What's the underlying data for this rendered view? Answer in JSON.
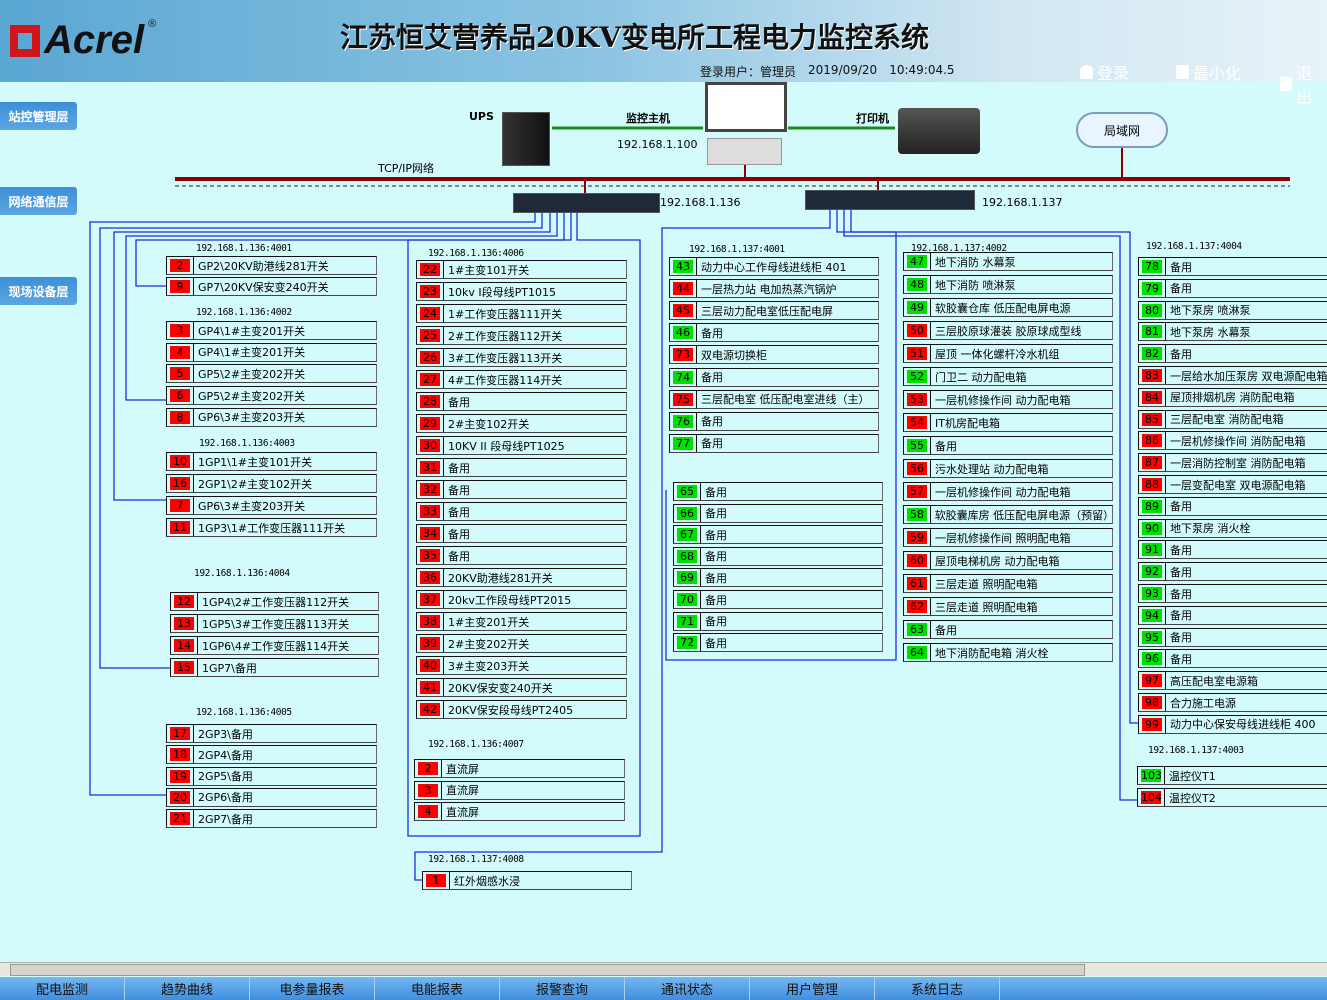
{
  "header": {
    "logo": "Acrel",
    "title": "江苏恒艾营养品20KV变电所工程电力监控系统",
    "user_label": "登录用户：",
    "user": "管理员",
    "date": "2019/09/20",
    "time": "10:49:04.5",
    "login": "登录",
    "minimize": "最小化",
    "exit": "退出"
  },
  "layers": {
    "station": "站控管理层",
    "network": "网络通信层",
    "field": "现场设备层"
  },
  "network": {
    "ups": "UPS",
    "host": "监控主机",
    "host_ip": "192.168.1.100",
    "printer": "打印机",
    "lan": "局域网",
    "tcp": "TCP/IP网络",
    "switch1_ip": "192.168.1.136",
    "switch2_ip": "192.168.1.137"
  },
  "colors": {
    "alarm": "#ff0000",
    "normal": "#00e000",
    "bus": "#8b0000",
    "link": "#1a8a1a",
    "wire": "#1a2fe0"
  },
  "groups": [
    {
      "ip": "192.168.1.136:4001",
      "items": [
        {
          "n": "2",
          "label": "GP2\\20KV助港线281开关",
          "s": "alarm"
        },
        {
          "n": "9",
          "label": "GP7\\20KV保安变240开关",
          "s": "alarm"
        }
      ]
    },
    {
      "ip": "192.168.1.136:4002",
      "items": [
        {
          "n": "3",
          "label": "GP4\\1#主变201开关",
          "s": "alarm"
        },
        {
          "n": "4",
          "label": "GP4\\1#主变201开关",
          "s": "alarm"
        },
        {
          "n": "5",
          "label": "GP5\\2#主变202开关",
          "s": "alarm"
        },
        {
          "n": "6",
          "label": "GP5\\2#主变202开关",
          "s": "alarm"
        },
        {
          "n": "8",
          "label": "GP6\\3#主变203开关",
          "s": "alarm"
        }
      ]
    },
    {
      "ip": "192.168.1.136:4003",
      "items": [
        {
          "n": "10",
          "label": "1GP1\\1#主变101开关",
          "s": "alarm"
        },
        {
          "n": "16",
          "label": "2GP1\\2#主变102开关",
          "s": "alarm"
        },
        {
          "n": "7",
          "label": "GP6\\3#主变203开关",
          "s": "alarm"
        },
        {
          "n": "11",
          "label": "1GP3\\1#工作变压器111开关",
          "s": "alarm"
        }
      ]
    },
    {
      "ip": "192.168.1.136:4004",
      "items": [
        {
          "n": "12",
          "label": "1GP4\\2#工作变压器112开关",
          "s": "alarm"
        },
        {
          "n": "13",
          "label": "1GP5\\3#工作变压器113开关",
          "s": "alarm"
        },
        {
          "n": "14",
          "label": "1GP6\\4#工作变压器114开关",
          "s": "alarm"
        },
        {
          "n": "15",
          "label": "1GP7\\备用",
          "s": "alarm"
        }
      ]
    },
    {
      "ip": "192.168.1.136:4005",
      "items": [
        {
          "n": "17",
          "label": "2GP3\\备用",
          "s": "alarm"
        },
        {
          "n": "18",
          "label": "2GP4\\备用",
          "s": "alarm"
        },
        {
          "n": "19",
          "label": "2GP5\\备用",
          "s": "alarm"
        },
        {
          "n": "20",
          "label": "2GP6\\备用",
          "s": "alarm"
        },
        {
          "n": "21",
          "label": "2GP7\\备用",
          "s": "alarm"
        }
      ]
    },
    {
      "ip": "192.168.1.136:4006",
      "items": [
        {
          "n": "22",
          "label": "1#主变101开关",
          "s": "alarm"
        },
        {
          "n": "23",
          "label": "10kv I段母线PT1015",
          "s": "alarm"
        },
        {
          "n": "24",
          "label": "1#工作变压器111开关",
          "s": "alarm"
        },
        {
          "n": "25",
          "label": "2#工作变压器112开关",
          "s": "alarm"
        },
        {
          "n": "26",
          "label": "3#工作变压器113开关",
          "s": "alarm"
        },
        {
          "n": "27",
          "label": "4#工作变压器114开关",
          "s": "alarm"
        },
        {
          "n": "28",
          "label": "备用",
          "s": "alarm"
        },
        {
          "n": "29",
          "label": "2#主变102开关",
          "s": "alarm"
        },
        {
          "n": "30",
          "label": "10KV II 段母线PT1025",
          "s": "alarm"
        },
        {
          "n": "31",
          "label": "备用",
          "s": "alarm"
        },
        {
          "n": "32",
          "label": "备用",
          "s": "alarm"
        },
        {
          "n": "33",
          "label": "备用",
          "s": "alarm"
        },
        {
          "n": "34",
          "label": "备用",
          "s": "alarm"
        },
        {
          "n": "35",
          "label": "备用",
          "s": "alarm"
        },
        {
          "n": "36",
          "label": "20KV助港线281开关",
          "s": "alarm"
        },
        {
          "n": "37",
          "label": "20kv工作段母线PT2015",
          "s": "alarm"
        },
        {
          "n": "38",
          "label": "1#主变201开关",
          "s": "alarm"
        },
        {
          "n": "39",
          "label": "2#主变202开关",
          "s": "alarm"
        },
        {
          "n": "40",
          "label": "3#主变203开关",
          "s": "alarm"
        },
        {
          "n": "41",
          "label": "20KV保安变240开关",
          "s": "alarm"
        },
        {
          "n": "42",
          "label": "20KV保安段母线PT2405",
          "s": "alarm"
        }
      ]
    },
    {
      "ip": "192.168.1.136:4007",
      "items": [
        {
          "n": "2",
          "label": "直流屏",
          "s": "alarm"
        },
        {
          "n": "3",
          "label": "直流屏",
          "s": "alarm"
        },
        {
          "n": "4",
          "label": "直流屏",
          "s": "alarm"
        }
      ]
    },
    {
      "ip": "192.168.1.137:4008",
      "items": [
        {
          "n": "1",
          "label": "红外烟感水浸",
          "s": "alarm"
        }
      ]
    },
    {
      "ip": "192.168.1.137:4001",
      "items": [
        {
          "n": "43",
          "label": "动力中心工作母线进线柜 401",
          "s": "normal"
        },
        {
          "n": "44",
          "label": "一层热力站 电加热蒸汽锅炉",
          "s": "alarm"
        },
        {
          "n": "45",
          "label": "三层动力配电室低压配电屏",
          "s": "alarm"
        },
        {
          "n": "46",
          "label": "备用",
          "s": "normal"
        },
        {
          "n": "73",
          "label": "双电源切换柜",
          "s": "alarm"
        },
        {
          "n": "74",
          "label": "备用",
          "s": "normal"
        },
        {
          "n": "75",
          "label": "三层配电室 低压配电室进线（主）",
          "s": "alarm"
        },
        {
          "n": "76",
          "label": "备用",
          "s": "normal"
        },
        {
          "n": "77",
          "label": "备用",
          "s": "normal"
        }
      ]
    },
    {
      "ip": "",
      "items": [
        {
          "n": "65",
          "label": "备用",
          "s": "normal"
        },
        {
          "n": "66",
          "label": "备用",
          "s": "normal"
        },
        {
          "n": "67",
          "label": "备用",
          "s": "normal"
        },
        {
          "n": "68",
          "label": "备用",
          "s": "normal"
        },
        {
          "n": "69",
          "label": "备用",
          "s": "normal"
        },
        {
          "n": "70",
          "label": "备用",
          "s": "normal"
        },
        {
          "n": "71",
          "label": "备用",
          "s": "normal"
        },
        {
          "n": "72",
          "label": "备用",
          "s": "normal"
        }
      ]
    },
    {
      "ip": "192.168.1.137:4002",
      "items": [
        {
          "n": "47",
          "label": "地下消防 水幕泵",
          "s": "normal"
        },
        {
          "n": "48",
          "label": "地下消防 喷淋泵",
          "s": "normal"
        },
        {
          "n": "49",
          "label": "软胶囊仓库 低压配电屏电源",
          "s": "normal"
        },
        {
          "n": "50",
          "label": "三层胶原球灌装 胶原球成型线",
          "s": "alarm"
        },
        {
          "n": "51",
          "label": "屋顶 一体化螺杆冷水机组",
          "s": "alarm"
        },
        {
          "n": "52",
          "label": "门卫二 动力配电箱",
          "s": "normal"
        },
        {
          "n": "53",
          "label": "一层机修操作间 动力配电箱",
          "s": "alarm"
        },
        {
          "n": "54",
          "label": "IT机房配电箱",
          "s": "alarm"
        },
        {
          "n": "55",
          "label": "备用",
          "s": "normal"
        },
        {
          "n": "56",
          "label": "污水处理站 动力配电箱",
          "s": "alarm"
        },
        {
          "n": "57",
          "label": "一层机修操作间 动力配电箱",
          "s": "alarm"
        },
        {
          "n": "58",
          "label": "软胶囊库房 低压配电屏电源（预留）",
          "s": "normal"
        },
        {
          "n": "59",
          "label": "一层机修操作间 照明配电箱",
          "s": "alarm"
        },
        {
          "n": "60",
          "label": "屋顶电梯机房 动力配电箱",
          "s": "alarm"
        },
        {
          "n": "61",
          "label": "三层走道 照明配电箱",
          "s": "alarm"
        },
        {
          "n": "62",
          "label": "三层走道 照明配电箱",
          "s": "alarm"
        },
        {
          "n": "63",
          "label": "备用",
          "s": "normal"
        },
        {
          "n": "64",
          "label": "地下消防配电箱 消火栓",
          "s": "normal"
        }
      ]
    },
    {
      "ip": "192.168.1.137:4004",
      "items": [
        {
          "n": "78",
          "label": "备用",
          "s": "normal"
        },
        {
          "n": "79",
          "label": "备用",
          "s": "normal"
        },
        {
          "n": "80",
          "label": "地下泵房 喷淋泵",
          "s": "normal"
        },
        {
          "n": "81",
          "label": "地下泵房 水幕泵",
          "s": "normal"
        },
        {
          "n": "82",
          "label": "备用",
          "s": "normal"
        },
        {
          "n": "83",
          "label": "一层给水加压泵房 双电源配电箱",
          "s": "alarm"
        },
        {
          "n": "84",
          "label": "屋顶排烟机房 消防配电箱",
          "s": "alarm"
        },
        {
          "n": "85",
          "label": "三层配电室 消防配电箱",
          "s": "alarm"
        },
        {
          "n": "86",
          "label": "一层机修操作间 消防配电箱",
          "s": "alarm"
        },
        {
          "n": "87",
          "label": "一层消防控制室 消防配电箱",
          "s": "alarm"
        },
        {
          "n": "88",
          "label": "一层变配电室 双电源配电箱",
          "s": "alarm"
        },
        {
          "n": "89",
          "label": "备用",
          "s": "normal"
        },
        {
          "n": "90",
          "label": "地下泵房 消火栓",
          "s": "normal"
        },
        {
          "n": "91",
          "label": "备用",
          "s": "normal"
        },
        {
          "n": "92",
          "label": "备用",
          "s": "normal"
        },
        {
          "n": "93",
          "label": "备用",
          "s": "normal"
        },
        {
          "n": "94",
          "label": "备用",
          "s": "normal"
        },
        {
          "n": "95",
          "label": "备用",
          "s": "normal"
        },
        {
          "n": "96",
          "label": "备用",
          "s": "normal"
        },
        {
          "n": "97",
          "label": "高压配电室电源箱",
          "s": "alarm"
        },
        {
          "n": "98",
          "label": "合力施工电源",
          "s": "alarm"
        },
        {
          "n": "99",
          "label": "动力中心保安母线进线柜 400",
          "s": "alarm"
        }
      ]
    },
    {
      "ip": "192.168.1.137:4003",
      "items": [
        {
          "n": "103",
          "label": "温控仪T1",
          "s": "normal"
        },
        {
          "n": "104",
          "label": "温控仪T2",
          "s": "alarm"
        }
      ]
    }
  ],
  "tabs": [
    "配电监测",
    "趋势曲线",
    "电参量报表",
    "电能报表",
    "报警查询",
    "通讯状态",
    "用户管理",
    "系统日志"
  ]
}
